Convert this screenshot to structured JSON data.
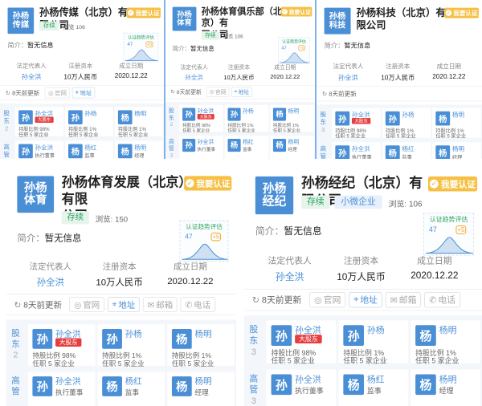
{
  "cards": [
    {
      "id": "c1",
      "logo": [
        "孙杨",
        "传媒"
      ],
      "name": [
        "孙杨传媒（北京）有限公司"
      ],
      "auth_label": "我要认证",
      "tags": [
        {
          "text": "存续",
          "kind": "green"
        }
      ],
      "views_label": "浏览",
      "views": "106",
      "intro_label": "简介：",
      "intro": "暂无信息",
      "trend": {
        "title": "认证趋势评估",
        "value": "47",
        "badge": "+5"
      },
      "info": [
        {
          "label": "法定代表人",
          "value": "孙全洪",
          "link": true
        },
        {
          "label": "注册资本",
          "value": "10万人民币",
          "link": false
        },
        {
          "label": "成立日期",
          "value": "2020.12.22",
          "link": false
        }
      ],
      "update": "8天前更新",
      "buttons": [
        {
          "label": "官网",
          "icon": "globe-icon",
          "on": false
        },
        {
          "label": "地址",
          "icon": "location-icon",
          "on": true
        }
      ],
      "sections": [
        {
          "label": "股东",
          "count": "2"
        },
        {
          "label": "高管",
          "count": "3"
        }
      ],
      "people": [
        [
          {
            "avatar": "孙",
            "name": "孙全洪",
            "badge": "大股东",
            "line1": "持股比例 98%",
            "line2": "任职 5 家企业"
          },
          {
            "avatar": "孙",
            "name": "孙杨",
            "badge": "",
            "line1": "持股比例 1%",
            "line2": "任职 5 家企业"
          },
          {
            "avatar": "杨",
            "name": "杨明",
            "badge": "",
            "line1": "持股比例 1%",
            "line2": "任职 5 家企业"
          }
        ],
        [
          {
            "avatar": "孙",
            "name": "孙全洪",
            "badge": "",
            "line1": "执行董事",
            "line2": ""
          },
          {
            "avatar": "杨",
            "name": "杨红",
            "badge": "",
            "line1": "监事",
            "line2": ""
          },
          {
            "avatar": "杨",
            "name": "杨明",
            "badge": "",
            "line1": "经理",
            "line2": ""
          }
        ]
      ]
    },
    {
      "id": "c2",
      "logo": [
        "孙杨",
        "体育"
      ],
      "name": [
        "孙杨体育俱乐部（北京）有",
        "限公司"
      ],
      "auth_label": "我要认证",
      "tags": [
        {
          "text": "存续",
          "kind": "green"
        }
      ],
      "views_label": "浏览",
      "views": "106",
      "intro_label": "简介：",
      "intro": "暂无信息",
      "trend": {
        "title": "认证趋势评估",
        "value": "47",
        "badge": "+5"
      },
      "info": [
        {
          "label": "法定代表人",
          "value": "孙全洪",
          "link": true
        },
        {
          "label": "注册资本",
          "value": "10万人民币",
          "link": false
        },
        {
          "label": "成立日期",
          "value": "2020.12.22",
          "link": false
        }
      ],
      "update": "8天前更新",
      "buttons": [
        {
          "label": "官网",
          "icon": "globe-icon",
          "on": false
        },
        {
          "label": "地址",
          "icon": "location-icon",
          "on": true
        }
      ],
      "sections": [
        {
          "label": "股东",
          "count": "2"
        },
        {
          "label": "高管",
          "count": "3"
        }
      ],
      "people": [
        [
          {
            "avatar": "孙",
            "name": "孙全洪",
            "badge": "大股东",
            "line1": "持股比例 98%",
            "line2": "任职 5 家企业"
          },
          {
            "avatar": "孙",
            "name": "孙杨",
            "badge": "",
            "line1": "持股比例 1%",
            "line2": "任职 5 家企业"
          },
          {
            "avatar": "杨",
            "name": "杨明",
            "badge": "",
            "line1": "持股比例 1%",
            "line2": "任职 5 家企业"
          }
        ],
        [
          {
            "avatar": "孙",
            "name": "孙全洪",
            "badge": "",
            "line1": "执行董事",
            "line2": ""
          },
          {
            "avatar": "杨",
            "name": "杨红",
            "badge": "",
            "line1": "监事",
            "line2": ""
          },
          {
            "avatar": "杨",
            "name": "杨明",
            "badge": "",
            "line1": "经理",
            "line2": ""
          }
        ]
      ]
    },
    {
      "id": "c3",
      "logo": [
        "孙杨",
        "科技"
      ],
      "name": [
        "孙杨科技（北京）有限公司"
      ],
      "auth_label": "我要认证",
      "tags": [],
      "views_label": "",
      "views": "",
      "intro_label": "简介：",
      "intro": "暂无信息",
      "trend": {
        "title": "",
        "value": "",
        "badge": ""
      },
      "info": [
        {
          "label": "法定代表人",
          "value": "孙全洪",
          "link": true
        },
        {
          "label": "注册资本",
          "value": "10万人民币",
          "link": false
        },
        {
          "label": "成立日期",
          "value": "2020.12.22",
          "link": false
        }
      ],
      "update": "8天前更新",
      "buttons": [],
      "sections": [
        {
          "label": "股东",
          "count": "3"
        },
        {
          "label": "高管",
          "count": "3"
        }
      ],
      "people": [
        [
          {
            "avatar": "孙",
            "name": "孙全洪",
            "badge": "大股东",
            "line1": "持股比例 98%",
            "line2": "任职 5 家企业"
          },
          {
            "avatar": "孙",
            "name": "孙杨",
            "badge": "",
            "line1": "持股比例 1%",
            "line2": "任职 5 家企业"
          },
          {
            "avatar": "杨",
            "name": "杨明",
            "badge": "",
            "line1": "持股比例 1%",
            "line2": "任职 5 家企业"
          }
        ],
        [
          {
            "avatar": "孙",
            "name": "孙全洪",
            "badge": "",
            "line1": "执行董事",
            "line2": ""
          },
          {
            "avatar": "杨",
            "name": "杨红",
            "badge": "",
            "line1": "监事",
            "line2": ""
          },
          {
            "avatar": "杨",
            "name": "杨明",
            "badge": "",
            "line1": "经理",
            "line2": ""
          }
        ]
      ]
    },
    {
      "id": "c4",
      "logo": [
        "孙杨",
        "体育"
      ],
      "name": [
        "孙杨体育发展（北京）有限",
        "公司"
      ],
      "auth_label": "我要认证",
      "tags": [
        {
          "text": "存续",
          "kind": "green"
        }
      ],
      "views_label": "浏览:",
      "views": "150",
      "intro_label": "简介：",
      "intro": "暂无信息",
      "trend": {
        "title": "认证趋势评估",
        "value": "47",
        "badge": "+5"
      },
      "info": [
        {
          "label": "法定代表人",
          "value": "孙全洪",
          "link": true
        },
        {
          "label": "注册资本",
          "value": "10万人民币",
          "link": false
        },
        {
          "label": "成立日期",
          "value": "2020.12.22",
          "link": false
        }
      ],
      "update": "8天前更新",
      "buttons": [
        {
          "label": "官网",
          "icon": "globe-icon",
          "on": false
        },
        {
          "label": "地址",
          "icon": "location-icon",
          "on": true
        },
        {
          "label": "邮箱",
          "icon": "mail-icon",
          "on": false
        },
        {
          "label": "电话",
          "icon": "phone-icon",
          "on": false
        }
      ],
      "sections": [
        {
          "label": "股东",
          "count": "2"
        },
        {
          "label": "高管",
          "count": ""
        }
      ],
      "people": [
        [
          {
            "avatar": "孙",
            "name": "孙全洪",
            "badge": "大股东",
            "line1": "持股比例 98%",
            "line2": "任职 5 家企业"
          },
          {
            "avatar": "孙",
            "name": "孙杨",
            "badge": "",
            "line1": "持股比例 1%",
            "line2": "任职 5 家企业"
          },
          {
            "avatar": "杨",
            "name": "杨明",
            "badge": "",
            "line1": "持股比例 1%",
            "line2": "任职 5 家企业"
          }
        ],
        [
          {
            "avatar": "孙",
            "name": "孙全洪",
            "badge": "",
            "line1": "执行董事",
            "line2": ""
          },
          {
            "avatar": "杨",
            "name": "杨红",
            "badge": "",
            "line1": "监事",
            "line2": ""
          },
          {
            "avatar": "杨",
            "name": "杨明",
            "badge": "",
            "line1": "经理",
            "line2": ""
          }
        ]
      ]
    },
    {
      "id": "c5",
      "logo": [
        "孙杨",
        "经纪"
      ],
      "name": [
        "孙杨经纪（北京）有限公司"
      ],
      "auth_label": "我要认证",
      "tags": [
        {
          "text": "存续",
          "kind": "green"
        },
        {
          "text": "小微企业",
          "kind": "blue"
        }
      ],
      "views_label": "浏览:",
      "views": "106",
      "intro_label": "简介：",
      "intro": "暂无信息",
      "trend": {
        "title": "认证趋势评估",
        "value": "47",
        "badge": "+5"
      },
      "info": [
        {
          "label": "法定代表人",
          "value": "孙全洪",
          "link": true
        },
        {
          "label": "注册资本",
          "value": "10万人民币",
          "link": false
        },
        {
          "label": "成立日期",
          "value": "2020.12.22",
          "link": false
        }
      ],
      "update": "8天前更新",
      "buttons": [
        {
          "label": "官网",
          "icon": "globe-icon",
          "on": false
        },
        {
          "label": "地址",
          "icon": "location-icon",
          "on": true
        },
        {
          "label": "邮箱",
          "icon": "mail-icon",
          "on": false
        },
        {
          "label": "电话",
          "icon": "phone-icon",
          "on": false
        }
      ],
      "sections": [
        {
          "label": "股东",
          "count": "3"
        },
        {
          "label": "高管",
          "count": "3"
        }
      ],
      "people": [
        [
          {
            "avatar": "孙",
            "name": "孙全洪",
            "badge": "大股东",
            "line1": "持股比例 98%",
            "line2": "任职 5 家企业"
          },
          {
            "avatar": "孙",
            "name": "孙杨",
            "badge": "",
            "line1": "持股比例 1%",
            "line2": "任职 5 家企业"
          },
          {
            "avatar": "杨",
            "name": "杨明",
            "badge": "",
            "line1": "持股比例 1%",
            "line2": "任职 5 家企业"
          }
        ],
        [
          {
            "avatar": "孙",
            "name": "孙全洪",
            "badge": "",
            "line1": "执行董事",
            "line2": ""
          },
          {
            "avatar": "杨",
            "name": "杨红",
            "badge": "",
            "line1": "监事",
            "line2": ""
          },
          {
            "avatar": "杨",
            "name": "杨明",
            "badge": "",
            "line1": "经理",
            "line2": ""
          }
        ]
      ]
    }
  ]
}
